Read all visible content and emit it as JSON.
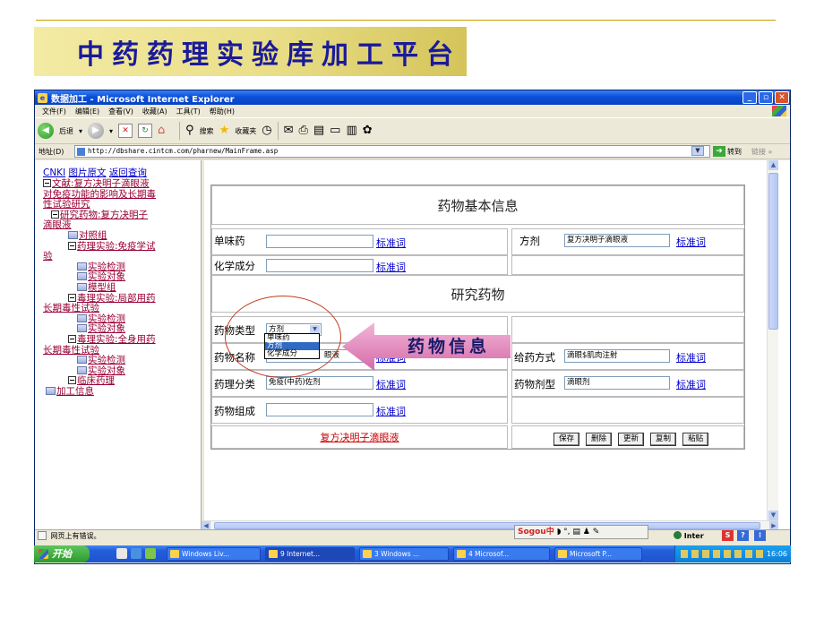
{
  "slide": {
    "title": "中药药理实验库加工平台"
  },
  "window": {
    "title": "数据加工 - Microsoft Internet Explorer",
    "menu": [
      "文件(F)",
      "编辑(E)",
      "查看(V)",
      "收藏(A)",
      "工具(T)",
      "帮助(H)"
    ],
    "toolbar": {
      "back": "后退",
      "search": "搜索",
      "favorites": "收藏夹"
    },
    "address_label": "地址(D)",
    "address": "http://dbshare.cintcm.com/pharnew/MainFrame.asp",
    "go": "转到",
    "links": "链接 »"
  },
  "left": {
    "top_links": [
      "CNKI",
      "图片原文",
      "返回查询"
    ],
    "tree": [
      {
        "text": "文献:复方决明子滴眼液",
        "kind": "box"
      },
      {
        "text": "对免疫功能的影响及长期毒",
        "kind": "cont"
      },
      {
        "text": "性试验研究",
        "kind": "cont"
      },
      {
        "text": "研究药物:复方决明子",
        "kind": "box"
      },
      {
        "text": "滴眼液",
        "kind": "cont"
      },
      {
        "text": "对照组",
        "kind": "doc"
      },
      {
        "text": "药理实验:免疫学试",
        "kind": "box"
      },
      {
        "text": "验",
        "kind": "cont"
      },
      {
        "text": "实验检测",
        "kind": "doc"
      },
      {
        "text": "实验对象",
        "kind": "doc"
      },
      {
        "text": "模型组",
        "kind": "doc"
      },
      {
        "text": "毒理实验:局部用药",
        "kind": "box"
      },
      {
        "text": "长期毒性试验",
        "kind": "cont"
      },
      {
        "text": "实验检测",
        "kind": "doc"
      },
      {
        "text": "实验对象",
        "kind": "doc"
      },
      {
        "text": "毒理实验:全身用药",
        "kind": "box"
      },
      {
        "text": "长期毒性试验",
        "kind": "cont"
      },
      {
        "text": "实验检测",
        "kind": "doc"
      },
      {
        "text": "实验对象",
        "kind": "doc"
      },
      {
        "text": "临床药理",
        "kind": "box"
      },
      {
        "text": "加工信息",
        "kind": "doc"
      }
    ]
  },
  "form": {
    "section1": "药物基本信息",
    "single_label": "单味药",
    "std_link": "标准词",
    "formula_label": "方剂",
    "formula_value": "复方决明子滴眼液",
    "chem_label": "化学成分",
    "section2": "研究药物",
    "type_label": "药物类型",
    "type_value": "方剂",
    "type_options": [
      "单味药",
      "方剂",
      "化学成分"
    ],
    "name_label": "药物名称",
    "name_value": "眼液",
    "route_label": "给药方式",
    "route_value": "滴眼$肌肉注射",
    "pharm_label": "药理分类",
    "pharm_value": "免疫(中药)佐剂",
    "dosage_label": "药物剂型",
    "dosage_value": "滴眼剂",
    "comp_label": "药物组成",
    "bottom_link": "复方决明子滴眼液",
    "buttons": [
      "保存",
      "删除",
      "更新",
      "复制",
      "粘贴"
    ]
  },
  "callout": "药物信息",
  "status": "网页上有错误。",
  "sogou": "Sogou中",
  "inter": "Inter",
  "taskbar": {
    "start": "开始",
    "tasks": [
      "Windows Liv...",
      "9 Internet...",
      "3 Windows ...",
      "4 Microsof...",
      "Microsoft P..."
    ],
    "clock": "16:06"
  },
  "colors": {
    "title_text": "#1a1a9a",
    "callout_arrow": "#e58fc0",
    "oval": "#c23a1c",
    "link": "#0000cc",
    "red_link": "#cc0000"
  }
}
